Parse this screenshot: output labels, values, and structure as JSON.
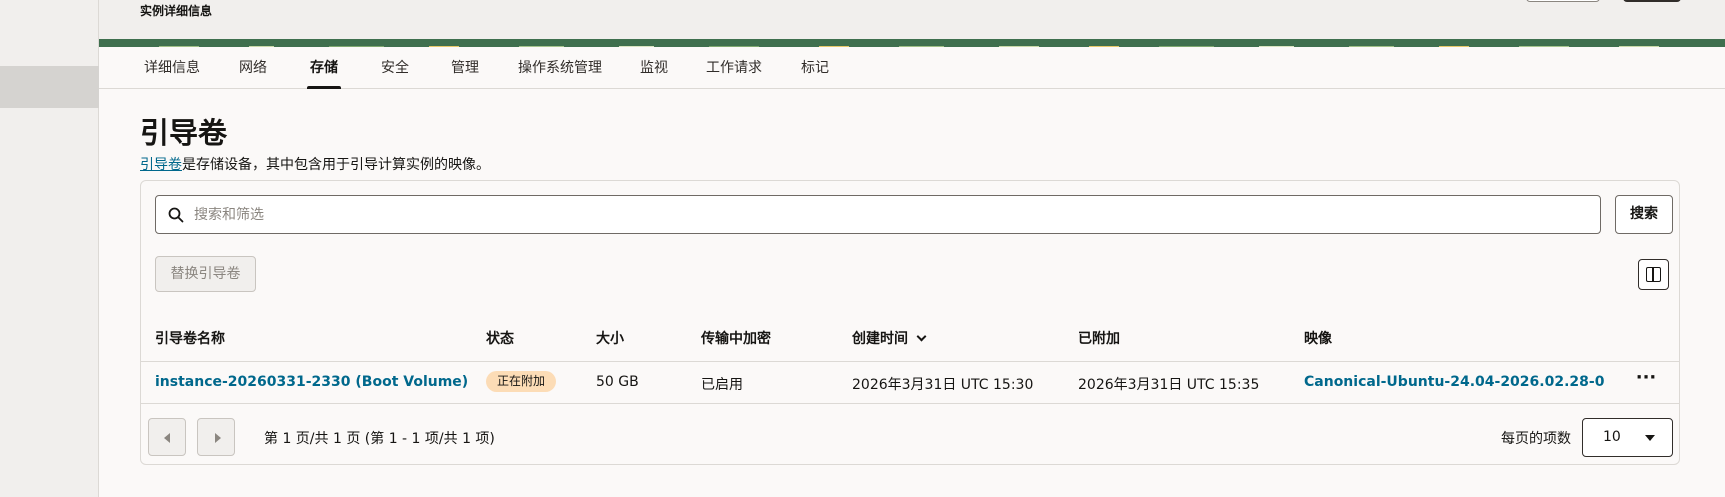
{
  "header": {
    "subtitle": "实例详细信息"
  },
  "tabs": [
    {
      "label": "详细信息",
      "active": false
    },
    {
      "label": "网络",
      "active": false
    },
    {
      "label": "存储",
      "active": true
    },
    {
      "label": "安全",
      "active": false
    },
    {
      "label": "管理",
      "active": false
    },
    {
      "label": "操作系统管理",
      "active": false
    },
    {
      "label": "监视",
      "active": false
    },
    {
      "label": "工作请求",
      "active": false
    },
    {
      "label": "标记",
      "active": false
    }
  ],
  "section": {
    "title": "引导卷",
    "desc_link": "引导卷",
    "desc_rest": "是存储设备，其中包含用于引导计算实例的映像。"
  },
  "search": {
    "placeholder": "搜索和筛选",
    "button_label": "搜索"
  },
  "actions": {
    "replace_label": "替换引导卷",
    "columns_icon": "columns-icon"
  },
  "table": {
    "headers": [
      "引导卷名称",
      "状态",
      "大小",
      "传输中加密",
      "创建时间",
      "已附加",
      "映像"
    ],
    "rows": [
      {
        "name": "instance-20260331-2330 (Boot Volume)",
        "status": "正在附加",
        "size": "50 GB",
        "encryption": "已启用",
        "created": "2026年3月31日 UTC 15:30",
        "attached": "2026年3月31日 UTC 15:35",
        "image": "Canonical-Ubuntu-24.04-2026.02.28-0",
        "more": "···"
      }
    ]
  },
  "pagination": {
    "info": "第 1 页/共 1 页 (第 1 - 1 项/共 1 项)",
    "per_page_label": "每页的项数",
    "per_page_value": "10"
  },
  "colors": {
    "link": "#00688c",
    "badge_bg": "#fcdcb6",
    "banner_green": "#3f6f4e"
  }
}
